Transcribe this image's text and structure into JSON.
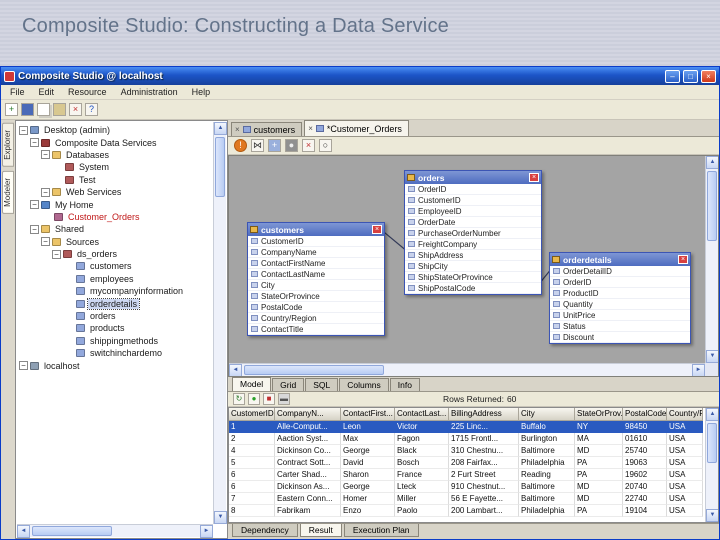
{
  "slide": {
    "title": "Composite Studio: Constructing a Data Service"
  },
  "window": {
    "title": "Composite Studio @ localhost",
    "controls": {
      "minimize": "–",
      "maximize": "□",
      "close": "×"
    },
    "menus": [
      "File",
      "Edit",
      "Resource",
      "Administration",
      "Help"
    ]
  },
  "main_toolbar": {
    "icons": [
      "new-resource-icon",
      "save-icon",
      "copy-icon",
      "paste-icon",
      "delete-icon",
      "help-icon"
    ]
  },
  "side_tabs": [
    {
      "label": "Explorer",
      "active": false
    },
    {
      "label": "Modeler",
      "active": true
    }
  ],
  "tree": {
    "items": [
      {
        "label": "Desktop (admin)",
        "depth": 0,
        "icon": "desktop",
        "expander": true
      },
      {
        "label": "Composite Data Services",
        "depth": 1,
        "icon": "services",
        "expander": true
      },
      {
        "label": "Databases",
        "depth": 2,
        "icon": "folder",
        "expander": true
      },
      {
        "label": "System",
        "depth": 3,
        "icon": "database"
      },
      {
        "label": "Test",
        "depth": 3,
        "icon": "database"
      },
      {
        "label": "Web Services",
        "depth": 2,
        "icon": "folder",
        "expander": true
      },
      {
        "label": "My Home",
        "depth": 1,
        "icon": "home",
        "expander": true
      },
      {
        "label": "Customer_Orders",
        "depth": 2,
        "icon": "model",
        "red": true
      },
      {
        "label": "Shared",
        "depth": 1,
        "icon": "folder",
        "expander": true
      },
      {
        "label": "Sources",
        "depth": 2,
        "icon": "folder",
        "expander": true
      },
      {
        "label": "ds_orders",
        "depth": 3,
        "icon": "database",
        "expander": true
      },
      {
        "label": "customers",
        "depth": 4,
        "icon": "table"
      },
      {
        "label": "employees",
        "depth": 4,
        "icon": "table"
      },
      {
        "label": "mycompanyinformation",
        "depth": 4,
        "icon": "table"
      },
      {
        "label": "orderdetails",
        "depth": 4,
        "icon": "table",
        "selected": true
      },
      {
        "label": "orders",
        "depth": 4,
        "icon": "table"
      },
      {
        "label": "products",
        "depth": 4,
        "icon": "table"
      },
      {
        "label": "shippingmethods",
        "depth": 4,
        "icon": "table"
      },
      {
        "label": "switchinchardemo",
        "depth": 4,
        "icon": "table"
      },
      {
        "label": "localhost",
        "depth": 0,
        "icon": "server",
        "expander": true
      }
    ]
  },
  "doc_tabs": [
    {
      "label": "customers",
      "active": false
    },
    {
      "label": "*Customer_Orders",
      "active": true
    }
  ],
  "canvas_toolbar": {
    "icons": [
      "validate-warning-icon",
      "join-icon",
      "add-table-icon",
      "snapshot-icon",
      "delete-icon",
      "find-icon"
    ]
  },
  "model": {
    "entities": [
      {
        "name": "customers",
        "fields": [
          "CustomerID",
          "CompanyName",
          "ContactFirstName",
          "ContactLastName",
          "City",
          "StateOrProvince",
          "PostalCode",
          "Country/Region",
          "ContactTitle"
        ]
      },
      {
        "name": "orders",
        "fields": [
          "OrderID",
          "CustomerID",
          "EmployeeID",
          "OrderDate",
          "PurchaseOrderNumber",
          "FreightCompany",
          "ShipAddress",
          "ShipCity",
          "ShipStateOrProvince",
          "ShipPostalCode"
        ]
      },
      {
        "name": "orderdetails",
        "fields": [
          "OrderDetailID",
          "OrderID",
          "ProductID",
          "Quantity",
          "UnitPrice",
          "Status",
          "Discount"
        ]
      }
    ]
  },
  "view_tabs": [
    {
      "label": "Model",
      "active": true
    },
    {
      "label": "Grid",
      "active": false
    },
    {
      "label": "SQL",
      "active": false
    },
    {
      "label": "Columns",
      "active": false
    },
    {
      "label": "Info",
      "active": false
    }
  ],
  "result_toolbar": {
    "icons": [
      "refresh-icon",
      "run-icon",
      "stop-icon",
      "print-icon"
    ],
    "rows_returned_label": "Rows Returned:",
    "rows_returned_value": "60"
  },
  "grid": {
    "columns": [
      "CustomerID",
      "CompanyN...",
      "ContactFirst...",
      "ContactLast...",
      "BillingAddress",
      "City",
      "StateOrProv...",
      "PostalCode",
      "Country/Re..."
    ],
    "selected_row_index": 0,
    "rows": [
      [
        "1",
        "Alle-Comput...",
        "Leon",
        "Victor",
        "225 Linc...",
        "Buffalo",
        "NY",
        "98450",
        "USA"
      ],
      [
        "2",
        "Aaction Syst...",
        "Max",
        "Fagon",
        "1715 Frontl...",
        "Burlington",
        "MA",
        "01610",
        "USA"
      ],
      [
        "4",
        "Dickinson Co...",
        "George",
        "Black",
        "310 Chestnu...",
        "Baltimore",
        "MD",
        "25740",
        "USA"
      ],
      [
        "5",
        "Contract Sott...",
        "David",
        "Bosch",
        "208 Fairfax...",
        "Philadelphia",
        "PA",
        "19063",
        "USA"
      ],
      [
        "6",
        "Carter Shad...",
        "Sharon",
        "France",
        "2 Furt Street",
        "Reading",
        "PA",
        "19602",
        "USA"
      ],
      [
        "6",
        "Dickinson As...",
        "George",
        "Lteck",
        "910 Chestnut...",
        "Baltimore",
        "MD",
        "20740",
        "USA"
      ],
      [
        "7",
        "Eastern Conn...",
        "Homer",
        "Miller",
        "56 E Fayette...",
        "Baltimore",
        "MD",
        "22740",
        "USA"
      ],
      [
        "8",
        "Fabrikam",
        "Enzo",
        "Paolo",
        "200 Lambart...",
        "Philadelphia",
        "PA",
        "19104",
        "USA"
      ]
    ]
  },
  "bottom_tabs": [
    {
      "label": "Dependency",
      "active": false
    },
    {
      "label": "Result",
      "active": true
    },
    {
      "label": "Execution Plan",
      "active": false
    }
  ]
}
